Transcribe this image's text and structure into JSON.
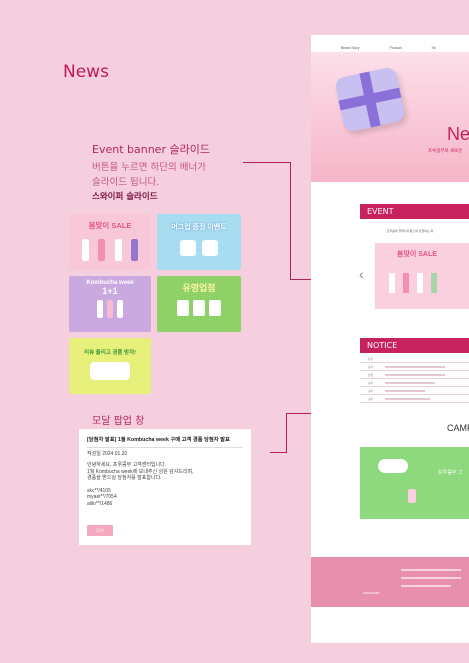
{
  "page": {
    "title": "News"
  },
  "event_section": {
    "heading": "Event banner 슬라이드",
    "desc_line1": "버튼을 누르면 하단의 배너가",
    "desc_line2": "슬라이드 됩니다.",
    "desc_bold": "스와이퍼 슬라이드"
  },
  "banners": [
    {
      "text": "봄맞이 SALE",
      "bg": "#f9c8d8"
    },
    {
      "text": "머그컵 증정 이벤트",
      "bg": "#a8dcf0"
    },
    {
      "text": "Kombucha week",
      "sub": "1+1",
      "bg": "#c9a9e0"
    },
    {
      "text": "유영업점",
      "bg": "#8fd067"
    },
    {
      "text": "리뷰 올리고 경품 받자!",
      "bg": "#e6f07a"
    }
  ],
  "modal_section": {
    "heading": "모달 팝업 창",
    "modal_title": "[당첨자 발표] 1월 Kombucha week 구매 고객 경품 당첨자 발표",
    "date": "작성일 2024.01.20",
    "body1": "안녕하세요, 프루콤부 고객센터입니다.",
    "body2": "1월 Kombucha week에 보내주신 성원 감사드리며,",
    "body3": "경품을 받으실 당첨자를 발표합니다.",
    "winner1": "skc**/4105",
    "winner2": "myaei**/7054",
    "winner3": "ailin**/1486",
    "button": "닫기"
  },
  "site": {
    "nav": [
      "Brand Story",
      "Product",
      "Se"
    ],
    "hero_title": "Ne",
    "hero_sub": "프루콤부와 새로운",
    "event_label": "EVENT",
    "event_sub": "프루콤부 플레이리워드와 만행하는 축",
    "event_banner_text": "봄맞이 SALE",
    "notice_label": "NOTICE",
    "notice_header": "분류",
    "notice_rows": [
      "공지",
      "당첨",
      "공지",
      "공지",
      "공지"
    ],
    "camp_title": "CAMP",
    "camp_banner_text": "프루콤부 그",
    "footer_logo": "FRUKOMBU"
  },
  "colors": {
    "accent": "#c7215e",
    "bg": "#f6cfdf",
    "line": "#b3205c"
  }
}
